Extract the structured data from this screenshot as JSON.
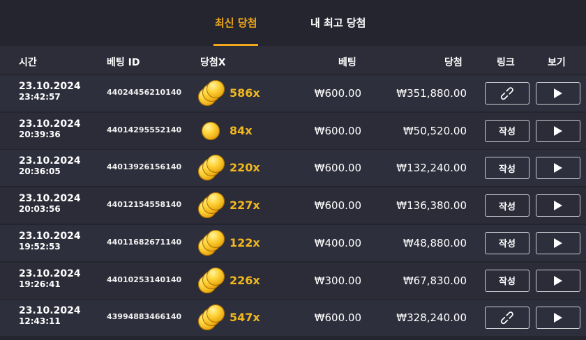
{
  "tabs": [
    {
      "label": "최신 당첨",
      "active": true
    },
    {
      "label": "내 최고 당첨",
      "active": false
    }
  ],
  "columns": {
    "time": "시간",
    "bet_id": "베팅 ID",
    "multiplier": "당첨X",
    "bet": "베팅",
    "win": "당첨",
    "link": "링크",
    "view": "보기"
  },
  "rows": [
    {
      "date": "23.10.2024",
      "time": "23:42:57",
      "bet_id": "44024456210140",
      "coins": 3,
      "multiplier": "586x",
      "bet": "₩600.00",
      "win": "₩351,880.00",
      "link_type": "link-icon",
      "link_label": ""
    },
    {
      "date": "23.10.2024",
      "time": "20:39:36",
      "bet_id": "44014295552140",
      "coins": 1,
      "multiplier": "84x",
      "bet": "₩600.00",
      "win": "₩50,520.00",
      "link_type": "text",
      "link_label": "작성"
    },
    {
      "date": "23.10.2024",
      "time": "20:36:05",
      "bet_id": "44013926156140",
      "coins": 3,
      "multiplier": "220x",
      "bet": "₩600.00",
      "win": "₩132,240.00",
      "link_type": "text",
      "link_label": "작성"
    },
    {
      "date": "23.10.2024",
      "time": "20:03:56",
      "bet_id": "44012154558140",
      "coins": 3,
      "multiplier": "227x",
      "bet": "₩600.00",
      "win": "₩136,380.00",
      "link_type": "text",
      "link_label": "작성"
    },
    {
      "date": "23.10.2024",
      "time": "19:52:53",
      "bet_id": "44011682671140",
      "coins": 3,
      "multiplier": "122x",
      "bet": "₩400.00",
      "win": "₩48,880.00",
      "link_type": "text",
      "link_label": "작성"
    },
    {
      "date": "23.10.2024",
      "time": "19:26:41",
      "bet_id": "44010253140140",
      "coins": 3,
      "multiplier": "226x",
      "bet": "₩300.00",
      "win": "₩67,830.00",
      "link_type": "text",
      "link_label": "작성"
    },
    {
      "date": "23.10.2024",
      "time": "12:43:11",
      "bet_id": "43994883466140",
      "coins": 3,
      "multiplier": "547x",
      "bet": "₩600.00",
      "win": "₩328,240.00",
      "link_type": "link-icon",
      "link_label": ""
    }
  ],
  "colors": {
    "accent": "#f2a81c",
    "multiplier": "#f2b81e"
  }
}
